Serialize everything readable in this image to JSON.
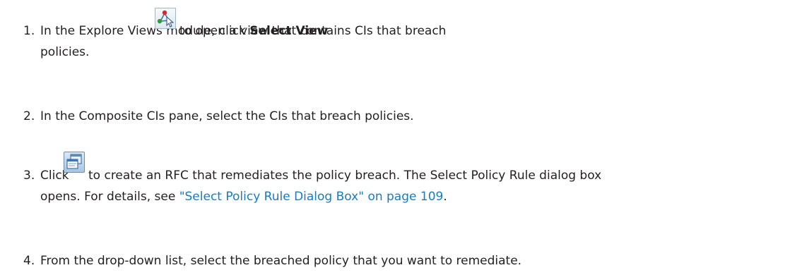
{
  "steps": [
    {
      "number": "1.",
      "line1_before": "In the Explore Views module, click ",
      "line1_bold": "Select View",
      "line1_after": "to open a view that contains CIs that breach",
      "line2": "policies.",
      "icon": "select-view-icon"
    },
    {
      "number": "2.",
      "line1": "In the Composite CIs pane, select the CIs that breach policies."
    },
    {
      "number": "3.",
      "line1_before": "Click",
      "line1_after": "to create an RFC that remediates the policy breach. The Select Policy Rule dialog box",
      "line2_before": "opens. For details, see ",
      "line2_link": "\"Select Policy Rule Dialog Box\" on page 109",
      "line2_after": ".",
      "icon": "create-rfc-icon"
    },
    {
      "number": "4.",
      "line1": "From the drop-down list, select the breached policy that you want to remediate."
    }
  ],
  "colors": {
    "text": "#231f20",
    "link": "#1a7bbd"
  }
}
